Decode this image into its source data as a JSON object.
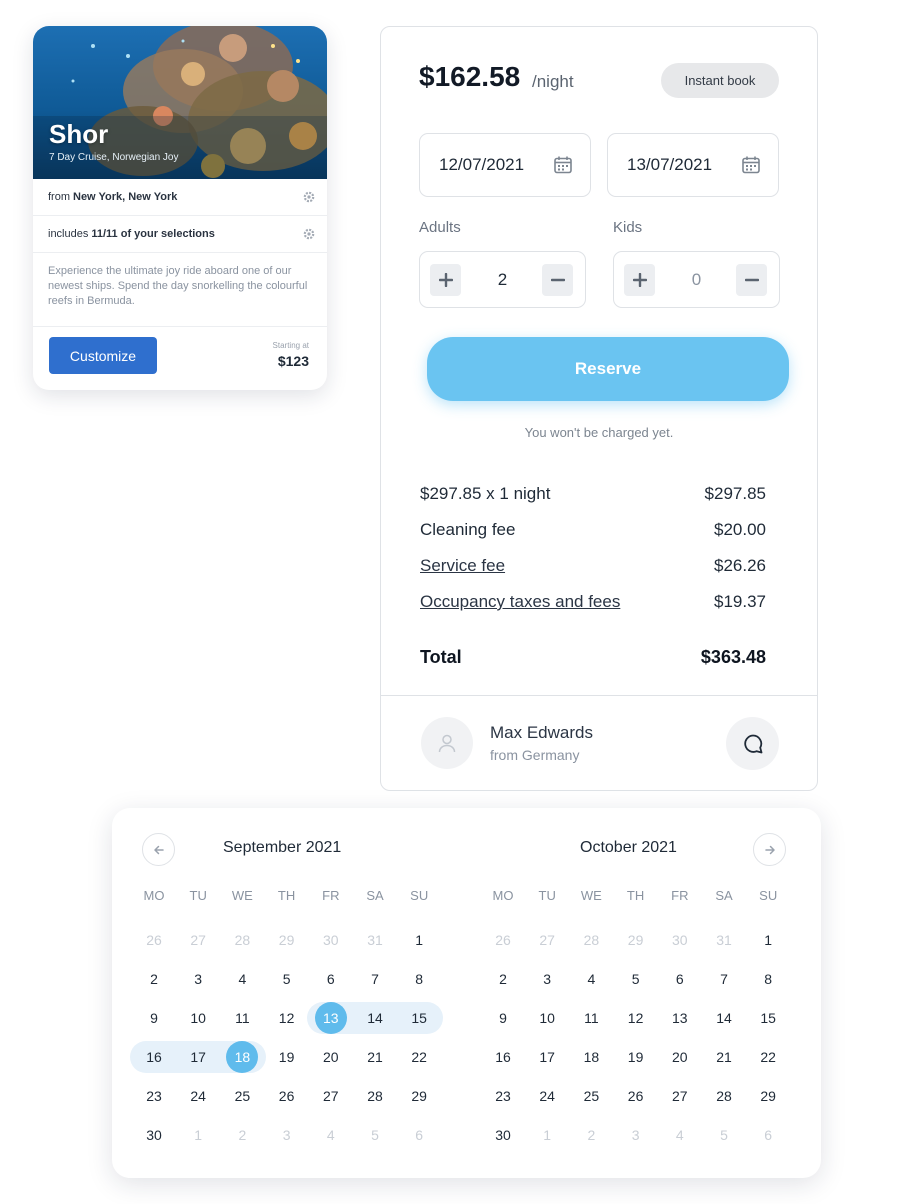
{
  "cruise": {
    "title": "Shor",
    "subtitle": "7 Day Cruise, Norwegian Joy",
    "from_prefix": "from",
    "from_value": "New York, New York",
    "includes_prefix": "includes",
    "includes_value": "11/11 of your selections",
    "description": "Experience the ultimate joy ride aboard one of our newest ships. Spend the day snorkelling the colourful reefs in Bermuda.",
    "customize_label": "Customize",
    "starting_label": "Starting at",
    "starting_price": "$123"
  },
  "booking": {
    "price": "$162.58",
    "price_unit": "/night",
    "instant_badge": "Instant book",
    "checkin": "12/07/2021",
    "checkout": "13/07/2021",
    "adults_label": "Adults",
    "adults_value": "2",
    "kids_label": "Kids",
    "kids_value": "0",
    "reserve_label": "Reserve",
    "charge_note": "You won't be charged yet.",
    "fees": [
      {
        "label": "$297.85 x 1 night",
        "amount": "$297.85"
      },
      {
        "label": "Cleaning fee",
        "amount": "$20.00"
      },
      {
        "label": "Service fee",
        "amount": "$26.26"
      },
      {
        "label": "Occupancy taxes and fees",
        "amount": "$19.37"
      }
    ],
    "total_label": "Total",
    "total_amount": "$363.48",
    "host_name": "Max Edwards",
    "host_from": "from Germany"
  },
  "calendar": {
    "weekdays": [
      "MO",
      "TU",
      "WE",
      "TH",
      "FR",
      "SA",
      "SU"
    ],
    "months": [
      {
        "title": "September 2021",
        "days": [
          [
            "26",
            "27",
            "28",
            "29",
            "30",
            "31",
            "1"
          ],
          [
            "2",
            "3",
            "4",
            "5",
            "6",
            "7",
            "8"
          ],
          [
            "9",
            "10",
            "11",
            "12",
            "13",
            "14",
            "15"
          ],
          [
            "16",
            "17",
            "18",
            "19",
            "20",
            "21",
            "22"
          ],
          [
            "23",
            "24",
            "25",
            "26",
            "27",
            "28",
            "29"
          ],
          [
            "30",
            "1",
            "2",
            "3",
            "4",
            "5",
            "6"
          ]
        ]
      },
      {
        "title": "October 2021",
        "days": [
          [
            "26",
            "27",
            "28",
            "29",
            "30",
            "31",
            "1"
          ],
          [
            "2",
            "3",
            "4",
            "5",
            "6",
            "7",
            "8"
          ],
          [
            "9",
            "10",
            "11",
            "12",
            "13",
            "14",
            "15"
          ],
          [
            "16",
            "17",
            "18",
            "19",
            "20",
            "21",
            "22"
          ],
          [
            "23",
            "24",
            "25",
            "26",
            "27",
            "28",
            "29"
          ],
          [
            "30",
            "1",
            "2",
            "3",
            "4",
            "5",
            "6"
          ]
        ]
      }
    ],
    "selection": {
      "start": "13",
      "end": "18",
      "month": "September 2021"
    }
  }
}
